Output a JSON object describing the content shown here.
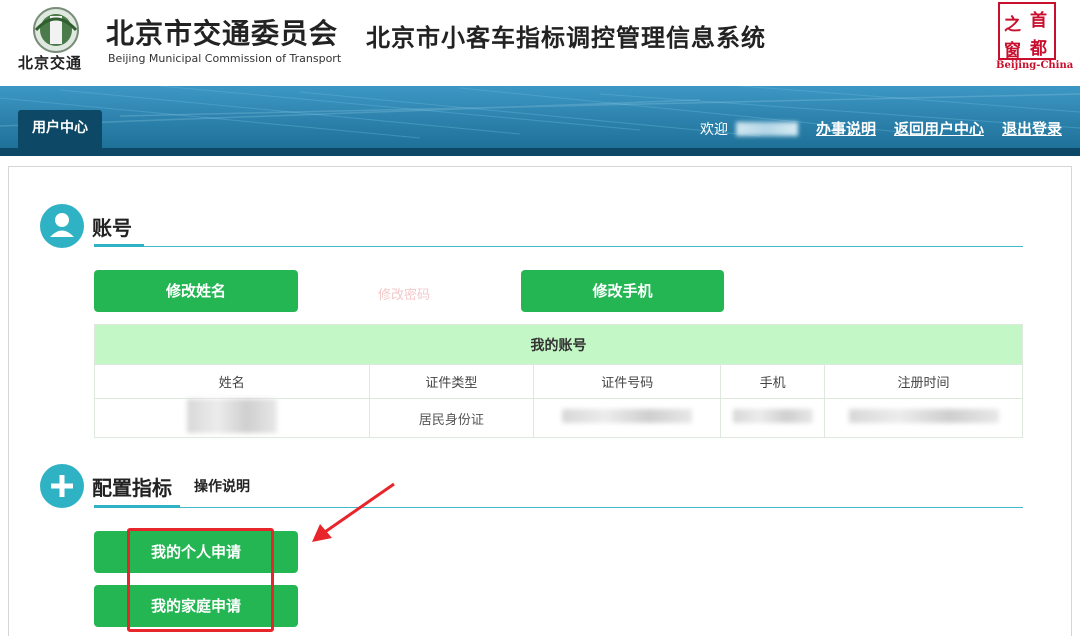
{
  "header": {
    "logo_text": "北京交通",
    "org_name_cn": "北京市交通委员会",
    "org_name_en": "Beijing Municipal Commission of Transport",
    "system_title": "北京市小客车指标调控管理信息系统",
    "badge": {
      "chars": [
        "之",
        "首",
        "窗",
        "都"
      ],
      "caption": "Beijing-China"
    }
  },
  "nav": {
    "tab_user_center": "用户中心",
    "welcome": "欢迎",
    "links": [
      "办事说明",
      "返回用户中心",
      "退出登录"
    ]
  },
  "account": {
    "title": "账号",
    "buttons": {
      "edit_name": "修改姓名",
      "edit_password": "修改密码",
      "edit_phone": "修改手机"
    },
    "table": {
      "caption": "我的账号",
      "headers": [
        "姓名",
        "证件类型",
        "证件号码",
        "手机",
        "注册时间"
      ],
      "row": {
        "id_type": "居民身份证"
      }
    }
  },
  "quota": {
    "title": "配置指标",
    "instructions": "操作说明",
    "buttons": {
      "personal": "我的个人申请",
      "family": "我的家庭申请"
    }
  },
  "colors": {
    "accent_green": "#23b653",
    "banner_blue": "#2a7fa9",
    "teal": "#2fb2c4",
    "highlight_red": "#e8252a"
  }
}
